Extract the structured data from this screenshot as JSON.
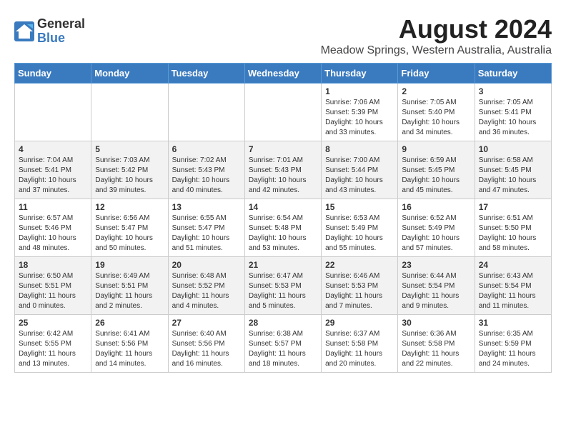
{
  "header": {
    "logo_general": "General",
    "logo_blue": "Blue",
    "month_year": "August 2024",
    "location": "Meadow Springs, Western Australia, Australia"
  },
  "days_of_week": [
    "Sunday",
    "Monday",
    "Tuesday",
    "Wednesday",
    "Thursday",
    "Friday",
    "Saturday"
  ],
  "weeks": [
    [
      {
        "day": "",
        "info": ""
      },
      {
        "day": "",
        "info": ""
      },
      {
        "day": "",
        "info": ""
      },
      {
        "day": "",
        "info": ""
      },
      {
        "day": "1",
        "info": "Sunrise: 7:06 AM\nSunset: 5:39 PM\nDaylight: 10 hours\nand 33 minutes."
      },
      {
        "day": "2",
        "info": "Sunrise: 7:05 AM\nSunset: 5:40 PM\nDaylight: 10 hours\nand 34 minutes."
      },
      {
        "day": "3",
        "info": "Sunrise: 7:05 AM\nSunset: 5:41 PM\nDaylight: 10 hours\nand 36 minutes."
      }
    ],
    [
      {
        "day": "4",
        "info": "Sunrise: 7:04 AM\nSunset: 5:41 PM\nDaylight: 10 hours\nand 37 minutes."
      },
      {
        "day": "5",
        "info": "Sunrise: 7:03 AM\nSunset: 5:42 PM\nDaylight: 10 hours\nand 39 minutes."
      },
      {
        "day": "6",
        "info": "Sunrise: 7:02 AM\nSunset: 5:43 PM\nDaylight: 10 hours\nand 40 minutes."
      },
      {
        "day": "7",
        "info": "Sunrise: 7:01 AM\nSunset: 5:43 PM\nDaylight: 10 hours\nand 42 minutes."
      },
      {
        "day": "8",
        "info": "Sunrise: 7:00 AM\nSunset: 5:44 PM\nDaylight: 10 hours\nand 43 minutes."
      },
      {
        "day": "9",
        "info": "Sunrise: 6:59 AM\nSunset: 5:45 PM\nDaylight: 10 hours\nand 45 minutes."
      },
      {
        "day": "10",
        "info": "Sunrise: 6:58 AM\nSunset: 5:45 PM\nDaylight: 10 hours\nand 47 minutes."
      }
    ],
    [
      {
        "day": "11",
        "info": "Sunrise: 6:57 AM\nSunset: 5:46 PM\nDaylight: 10 hours\nand 48 minutes."
      },
      {
        "day": "12",
        "info": "Sunrise: 6:56 AM\nSunset: 5:47 PM\nDaylight: 10 hours\nand 50 minutes."
      },
      {
        "day": "13",
        "info": "Sunrise: 6:55 AM\nSunset: 5:47 PM\nDaylight: 10 hours\nand 51 minutes."
      },
      {
        "day": "14",
        "info": "Sunrise: 6:54 AM\nSunset: 5:48 PM\nDaylight: 10 hours\nand 53 minutes."
      },
      {
        "day": "15",
        "info": "Sunrise: 6:53 AM\nSunset: 5:49 PM\nDaylight: 10 hours\nand 55 minutes."
      },
      {
        "day": "16",
        "info": "Sunrise: 6:52 AM\nSunset: 5:49 PM\nDaylight: 10 hours\nand 57 minutes."
      },
      {
        "day": "17",
        "info": "Sunrise: 6:51 AM\nSunset: 5:50 PM\nDaylight: 10 hours\nand 58 minutes."
      }
    ],
    [
      {
        "day": "18",
        "info": "Sunrise: 6:50 AM\nSunset: 5:51 PM\nDaylight: 11 hours\nand 0 minutes."
      },
      {
        "day": "19",
        "info": "Sunrise: 6:49 AM\nSunset: 5:51 PM\nDaylight: 11 hours\nand 2 minutes."
      },
      {
        "day": "20",
        "info": "Sunrise: 6:48 AM\nSunset: 5:52 PM\nDaylight: 11 hours\nand 4 minutes."
      },
      {
        "day": "21",
        "info": "Sunrise: 6:47 AM\nSunset: 5:53 PM\nDaylight: 11 hours\nand 5 minutes."
      },
      {
        "day": "22",
        "info": "Sunrise: 6:46 AM\nSunset: 5:53 PM\nDaylight: 11 hours\nand 7 minutes."
      },
      {
        "day": "23",
        "info": "Sunrise: 6:44 AM\nSunset: 5:54 PM\nDaylight: 11 hours\nand 9 minutes."
      },
      {
        "day": "24",
        "info": "Sunrise: 6:43 AM\nSunset: 5:54 PM\nDaylight: 11 hours\nand 11 minutes."
      }
    ],
    [
      {
        "day": "25",
        "info": "Sunrise: 6:42 AM\nSunset: 5:55 PM\nDaylight: 11 hours\nand 13 minutes."
      },
      {
        "day": "26",
        "info": "Sunrise: 6:41 AM\nSunset: 5:56 PM\nDaylight: 11 hours\nand 14 minutes."
      },
      {
        "day": "27",
        "info": "Sunrise: 6:40 AM\nSunset: 5:56 PM\nDaylight: 11 hours\nand 16 minutes."
      },
      {
        "day": "28",
        "info": "Sunrise: 6:38 AM\nSunset: 5:57 PM\nDaylight: 11 hours\nand 18 minutes."
      },
      {
        "day": "29",
        "info": "Sunrise: 6:37 AM\nSunset: 5:58 PM\nDaylight: 11 hours\nand 20 minutes."
      },
      {
        "day": "30",
        "info": "Sunrise: 6:36 AM\nSunset: 5:58 PM\nDaylight: 11 hours\nand 22 minutes."
      },
      {
        "day": "31",
        "info": "Sunrise: 6:35 AM\nSunset: 5:59 PM\nDaylight: 11 hours\nand 24 minutes."
      }
    ]
  ]
}
